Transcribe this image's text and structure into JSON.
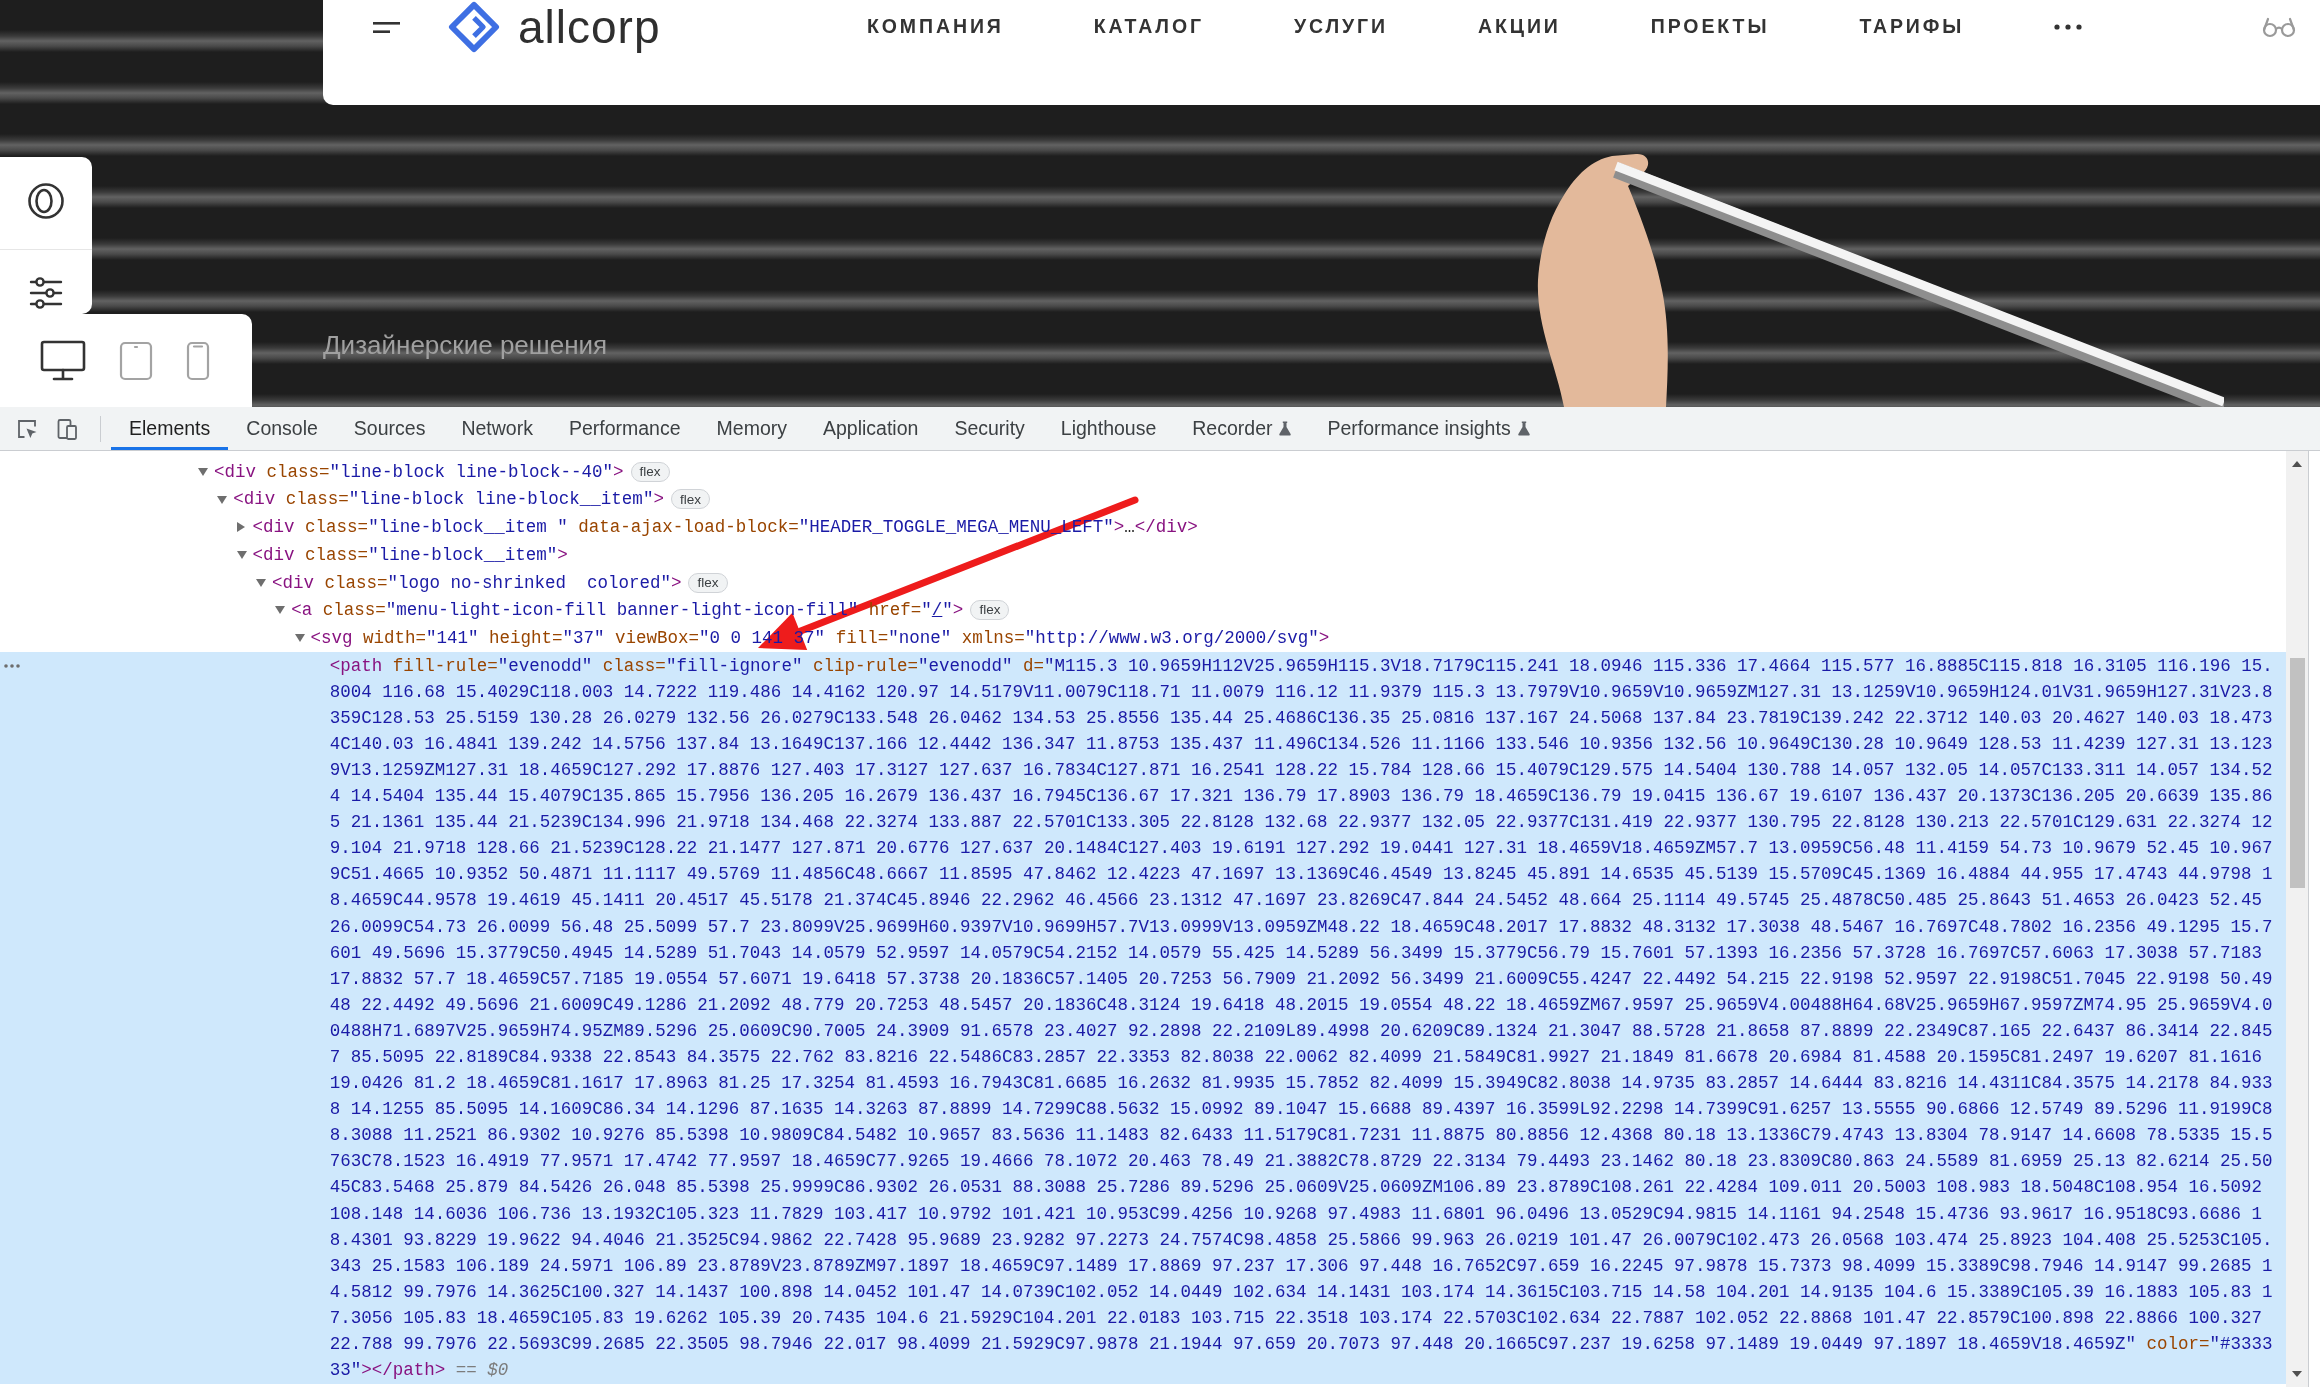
{
  "site_header": {
    "logo_text": "allcorp",
    "nav": [
      "КОМПАНИЯ",
      "КАТАЛОГ",
      "УСЛУГИ",
      "АКЦИИ",
      "ПРОЕКТЫ",
      "ТАРИФЫ"
    ]
  },
  "hero": {
    "subtitle": "Дизайнерские решения"
  },
  "device_switcher": [
    {
      "kind": "desktop",
      "selected": true
    },
    {
      "kind": "tablet",
      "selected": false
    },
    {
      "kind": "phone",
      "selected": false
    }
  ],
  "devtools": {
    "tabs": [
      {
        "label": "Elements",
        "selected": true,
        "experimental": false
      },
      {
        "label": "Console",
        "selected": false,
        "experimental": false
      },
      {
        "label": "Sources",
        "selected": false,
        "experimental": false
      },
      {
        "label": "Network",
        "selected": false,
        "experimental": false
      },
      {
        "label": "Performance",
        "selected": false,
        "experimental": false
      },
      {
        "label": "Memory",
        "selected": false,
        "experimental": false
      },
      {
        "label": "Application",
        "selected": false,
        "experimental": false
      },
      {
        "label": "Security",
        "selected": false,
        "experimental": false
      },
      {
        "label": "Lighthouse",
        "selected": false,
        "experimental": false
      },
      {
        "label": "Recorder",
        "selected": false,
        "experimental": true
      },
      {
        "label": "Performance insights",
        "selected": false,
        "experimental": true
      }
    ],
    "dom_tree": [
      {
        "expandable": true,
        "expanded": true,
        "selected": false,
        "tokens": [
          {
            "kind": "tag",
            "text": "<div"
          },
          {
            "kind": "attr-name",
            "text": " class="
          },
          {
            "kind": "attr-value",
            "text": "\"line-block line-block--40\""
          },
          {
            "kind": "tag",
            "text": ">"
          }
        ],
        "badge": "flex",
        "children": [
          {
            "expandable": true,
            "expanded": true,
            "selected": false,
            "tokens": [
              {
                "kind": "tag",
                "text": "<div"
              },
              {
                "kind": "attr-name",
                "text": " class="
              },
              {
                "kind": "attr-value",
                "text": "\"line-block line-block__item\""
              },
              {
                "kind": "tag",
                "text": ">"
              }
            ],
            "badge": "flex",
            "children": [
              {
                "expandable": true,
                "expanded": false,
                "selected": false,
                "tokens": [
                  {
                    "kind": "tag",
                    "text": "<div"
                  },
                  {
                    "kind": "attr-name",
                    "text": " class="
                  },
                  {
                    "kind": "attr-value",
                    "text": "\"line-block__item \""
                  },
                  {
                    "kind": "attr-name",
                    "text": " data-ajax-load-block="
                  },
                  {
                    "kind": "attr-value",
                    "text": "\"HEADER_TOGGLE_MEGA_MENU_LEFT\""
                  },
                  {
                    "kind": "tag",
                    "text": ">"
                  },
                  {
                    "kind": "text",
                    "text": "…"
                  },
                  {
                    "kind": "tag",
                    "text": "</div>"
                  }
                ]
              },
              {
                "expandable": true,
                "expanded": true,
                "selected": false,
                "tokens": [
                  {
                    "kind": "tag",
                    "text": "<div"
                  },
                  {
                    "kind": "attr-name",
                    "text": " class="
                  },
                  {
                    "kind": "attr-value",
                    "text": "\"line-block__item\""
                  },
                  {
                    "kind": "tag",
                    "text": ">"
                  }
                ],
                "children": [
                  {
                    "expandable": true,
                    "expanded": true,
                    "selected": false,
                    "tokens": [
                      {
                        "kind": "tag",
                        "text": "<div"
                      },
                      {
                        "kind": "attr-name",
                        "text": " class="
                      },
                      {
                        "kind": "attr-value",
                        "text": "\"logo no-shrinked  colored\""
                      },
                      {
                        "kind": "tag",
                        "text": ">"
                      }
                    ],
                    "badge": "flex",
                    "children": [
                      {
                        "expandable": true,
                        "expanded": true,
                        "selected": false,
                        "tokens": [
                          {
                            "kind": "tag",
                            "text": "<a"
                          },
                          {
                            "kind": "attr-name",
                            "text": " class="
                          },
                          {
                            "kind": "attr-value",
                            "text": "\"menu-light-icon-fill banner-light-icon-fill\""
                          },
                          {
                            "kind": "attr-name",
                            "text": " href="
                          },
                          {
                            "kind": "attr-value",
                            "text": "\""
                          },
                          {
                            "kind": "link",
                            "text": "/"
                          },
                          {
                            "kind": "attr-value",
                            "text": "\""
                          },
                          {
                            "kind": "tag",
                            "text": ">"
                          }
                        ],
                        "badge": "flex",
                        "children": [
                          {
                            "expandable": true,
                            "expanded": true,
                            "selected": false,
                            "tokens": [
                              {
                                "kind": "tag",
                                "text": "<svg"
                              },
                              {
                                "kind": "attr-name",
                                "text": " width="
                              },
                              {
                                "kind": "attr-value",
                                "text": "\"141\""
                              },
                              {
                                "kind": "attr-name",
                                "text": " height="
                              },
                              {
                                "kind": "attr-value",
                                "text": "\"37\""
                              },
                              {
                                "kind": "attr-name",
                                "text": " viewBox="
                              },
                              {
                                "kind": "attr-value",
                                "text": "\"0 0 141 37\""
                              },
                              {
                                "kind": "attr-name",
                                "text": " fill="
                              },
                              {
                                "kind": "attr-value",
                                "text": "\"none\""
                              },
                              {
                                "kind": "attr-name",
                                "text": " xmlns="
                              },
                              {
                                "kind": "attr-value",
                                "text": "\"http://www.w3.org/2000/svg\""
                              },
                              {
                                "kind": "tag",
                                "text": ">"
                              }
                            ],
                            "children": [
                              {
                                "expandable": false,
                                "selected": true,
                                "tokens": [
                                  {
                                    "kind": "tag",
                                    "text": "<path"
                                  },
                                  {
                                    "kind": "attr-name",
                                    "text": " fill-rule="
                                  },
                                  {
                                    "kind": "attr-value",
                                    "text": "\"evenodd\""
                                  },
                                  {
                                    "kind": "attr-name",
                                    "text": " class="
                                  },
                                  {
                                    "kind": "attr-value",
                                    "text": "\"fill-ignore\""
                                  },
                                  {
                                    "kind": "attr-name",
                                    "text": " clip-rule="
                                  },
                                  {
                                    "kind": "attr-value",
                                    "text": "\"evenodd\""
                                  },
                                  {
                                    "kind": "attr-name",
                                    "text": " d="
                                  },
                                  {
                                    "kind": "attr-value",
                                    "text": "\"M115.3 10.9659H112V25.9659H115.3V18.7179C115.241 18.0946 115.336 17.4664 115.577 16.8885C115.818 16.3105 116.196 15.8004 116.68 15.4029C118.003 14.7222 119.486 14.4162 120.97 14.5179V11.0079C118.71 11.0079 116.12 11.9379 115.3 13.7979V10.9659V10.9659ZM127.31 13.1259V10.9659H124.01V31.9659H127.31V23.8359C128.53 25.5159 130.28 26.0279 132.56 26.0279C133.548 26.0462 134.53 25.8556 135.44 25.4686C136.35 25.0816 137.167 24.5068 137.84 23.7819C139.242 22.3712 140.03 20.4627 140.03 18.4734C140.03 16.4841 139.242 14.5756 137.84 13.1649C137.166 12.4442 136.347 11.8753 135.437 11.496C134.526 11.1166 133.546 10.9356 132.56 10.9649C130.28 10.9649 128.53 11.4239 127.31 13.1239V13.1259ZM127.31 18.4659C127.292 17.8876 127.403 17.3127 127.637 16.7834C127.871 16.2541 128.22 15.784 128.66 15.4079C129.575 14.5404 130.788 14.057 132.05 14.057C133.311 14.057 134.524 14.5404 135.44 15.4079C135.865 15.7956 136.205 16.2679 136.437 16.7945C136.67 17.321 136.79 17.8903 136.79 18.4659C136.79 19.0415 136.67 19.6107 136.437 20.1373C136.205 20.6639 135.865 21.1361 135.44 21.5239C134.996 21.9718 134.468 22.3274 133.887 22.5701C133.305 22.8128 132.68 22.9377 132.05 22.9377C131.419 22.9377 130.795 22.8128 130.213 22.5701C129.631 22.3274 129.104 21.9718 128.66 21.5239C128.22 21.1477 127.871 20.6776 127.637 20.1484C127.403 19.6191 127.292 19.0441 127.31 18.4659V18.4659ZM57.7 13.0959C56.48 11.4159 54.73 10.9679 52.45 10.9679C51.4665 10.9352 50.4871 11.1117 49.5769 11.4856C48.6667 11.8595 47.8462 12.4223 47.1697 13.1369C46.4549 13.8245 45.891 14.6535 45.5139 15.5709C45.1369 16.4884 44.955 17.4743 44.9798 18.4659C44.9578 19.4619 45.1411 20.4517 45.5178 21.374C45.8946 22.2962 46.4566 23.1312 47.1697 23.8269C47.844 24.5452 48.664 25.1114 49.5745 25.4878C50.485 25.8643 51.4653 26.0423 52.45 26.0099C54.73 26.0099 56.48 25.5099 57.7 23.8099V25.9699H60.9397V10.9699H57.7V13.0999V13.0959ZM48.22 18.4659C48.2017 17.8832 48.3132 17.3038 48.5467 16.7697C48.7802 16.2356 49.1295 15.7601 49.5696 15.3779C50.4945 14.5289 51.7043 14.0579 52.9597 14.0579C54.2152 14.0579 55.425 14.5289 56.3499 15.3779C56.79 15.7601 57.1393 16.2356 57.3728 16.7697C57.6063 17.3038 57.7183 17.8832 57.7 18.4659C57.7185 19.0554 57.6071 19.6418 57.3738 20.1836C57.1405 20.7253 56.7909 21.2092 56.3499 21.6009C55.4247 22.4492 54.215 22.9198 52.9597 22.9198C51.7045 22.9198 50.4948 22.4492 49.5696 21.6009C49.1286 21.2092 48.779 20.7253 48.5457 20.1836C48.3124 19.6418 48.2015 19.0554 48.22 18.4659ZM67.9597 25.9659V4.00488H64.68V25.9659H67.9597ZM74.95 25.9659V4.00488H71.6897V25.9659H74.95ZM89.5296 25.0609C90.7005 24.3909 91.6578 23.4027 92.2898 22.2109L89.4998 20.6209C89.1324 21.3047 88.5728 21.8658 87.8899 22.2349C87.165 22.6437 86.3414 22.8457 85.5095 22.8189C84.9338 22.8543 84.3575 22.762 83.8216 22.5486C83.2857 22.3353 82.8038 22.0062 82.4099 21.5849C81.9927 21.1849 81.6678 20.6984 81.4588 20.1595C81.2497 19.6207 81.1616 19.0426 81.2 18.4659C81.1617 17.8963 81.25 17.3254 81.4593 16.7943C81.6685 16.2632 81.9935 15.7852 82.4099 15.3949C82.8038 14.9735 83.2857 14.6444 83.8216 14.4311C84.3575 14.2178 84.9338 14.1255 85.5095 14.1609C86.34 14.1296 87.1635 14.3263 87.8899 14.7299C88.5632 15.0992 89.1047 15.6688 89.4397 16.3599L92.2298 14.7399C91.6257 13.5555 90.6866 12.5749 89.5296 11.9199C88.3088 11.2521 86.9302 10.9276 85.5398 10.9809C84.5482 10.9657 83.5636 11.1483 82.6433 11.5179C81.7231 11.8875 80.8856 12.4368 80.18 13.1336C79.4743 13.8304 78.9147 14.6608 78.5335 15.5763C78.1523 16.4919 77.9571 17.4742 77.9597 18.4659C77.9265 19.4666 78.1072 20.463 78.49 21.3882C78.8729 22.3134 79.4493 23.1462 80.18 23.8309C80.863 24.5589 81.6959 25.13 82.6214 25.5045C83.5468 25.879 84.5426 26.048 85.5398 25.9999C86.9302 26.0531 88.3088 25.7286 89.5296 25.0609V25.0609ZM106.89 23.8789C108.261 22.4284 109.011 20.5003 108.983 18.5048C108.954 16.5092 108.148 14.6036 106.736 13.1932C105.323 11.7829 103.417 10.9792 101.421 10.953C99.4256 10.9268 97.4983 11.6801 96.0496 13.0529C94.9815 14.1161 94.2548 15.4736 93.9617 16.9518C93.6686 18.4301 93.8229 19.9622 94.4046 21.3525C94.9862 22.7428 95.9689 23.9282 97.2273 24.7574C98.4858 25.5866 99.963 26.0219 101.47 26.0079C102.473 26.0568 103.474 25.8923 104.408 25.5253C105.343 25.1583 106.189 24.5971 106.89 23.8789V23.8789ZM97.1897 18.4659C97.1489 17.8869 97.237 17.306 97.448 16.7652C97.659 16.2245 97.9878 15.7373 98.4099 15.3389C98.7946 14.9147 99.2685 14.5812 99.7976 14.3625C100.327 14.1437 100.898 14.0452 101.47 14.0739C102.052 14.0449 102.634 14.1431 103.174 14.3615C103.715 14.58 104.201 14.9135 104.6 15.3389C105.39 16.1883 105.83 17.3056 105.83 18.4659C105.83 19.6262 105.39 20.7435 104.6 21.5929C104.201 22.0183 103.715 22.3518 103.174 22.5703C102.634 22.7887 102.052 22.8868 101.47 22.8579C100.898 22.8866 100.327 22.788 99.7976 22.5693C99.2685 22.3505 98.7946 22.017 98.4099 21.5929C97.9878 21.1944 97.659 20.7073 97.448 20.1665C97.237 19.6258 97.1489 19.0449 97.1897 18.4659V18.4659Z\""
                                  },
                                  {
                                    "kind": "attr-name",
                                    "text": " color="
                                  },
                                  {
                                    "kind": "attr-value",
                                    "text": "\"#333333\""
                                  },
                                  {
                                    "kind": "tag",
                                    "text": "></path>"
                                  },
                                  {
                                    "kind": "console-ref",
                                    "text": " == *$0*"
                                  }
                                ]
                              }
                            ]
                          }
                        ]
                      }
                    ]
                  }
                ]
              }
            ]
          }
        ]
      }
    ]
  }
}
